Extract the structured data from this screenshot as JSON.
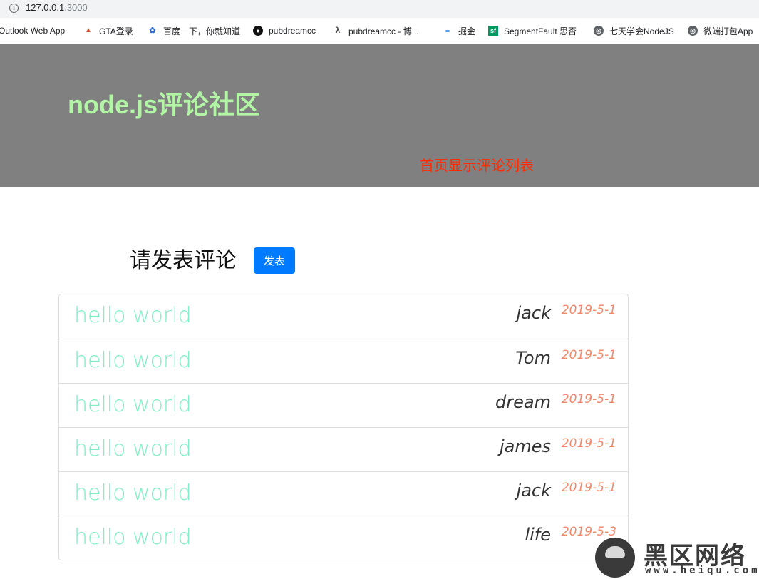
{
  "browser": {
    "url_host": "127.0.0.1",
    "url_port": ":3000",
    "bookmarks": [
      {
        "label": "Outlook Web App",
        "icon": "outlook-icon"
      },
      {
        "label": "GTA登录",
        "icon": "gta-icon"
      },
      {
        "label": "百度一下，你就知道",
        "icon": "baidu-paw-icon"
      },
      {
        "label": "pubdreamcc",
        "icon": "github-icon"
      },
      {
        "label": "pubdreamcc - 博...",
        "icon": "cnblogs-icon"
      },
      {
        "label": "掘金",
        "icon": "juejin-icon"
      },
      {
        "label": "SegmentFault 思否",
        "icon": "segmentfault-icon"
      },
      {
        "label": "七天学会NodeJS",
        "icon": "globe-icon"
      },
      {
        "label": "微端打包App",
        "icon": "globe-icon"
      }
    ]
  },
  "header": {
    "title": "node.js评论社区",
    "link": "首页显示评论列表"
  },
  "compose": {
    "title": "请发表评论",
    "button": "发表"
  },
  "comments": [
    {
      "content": "hello world",
      "author": "jack",
      "date": "2019-5-1"
    },
    {
      "content": "hello world",
      "author": "Tom",
      "date": "2019-5-1"
    },
    {
      "content": "hello world",
      "author": "dream",
      "date": "2019-5-1"
    },
    {
      "content": "hello world",
      "author": "james",
      "date": "2019-5-1"
    },
    {
      "content": "hello world",
      "author": "jack",
      "date": "2019-5-1"
    },
    {
      "content": "hello world",
      "author": "life",
      "date": "2019-5-3"
    }
  ],
  "watermark": {
    "title": "黑区网络",
    "url": "www.heiqu.com"
  },
  "colors": {
    "header_bg": "#808080",
    "title": "#b2f5a5",
    "header_link": "#ff2a00",
    "button": "#007bff",
    "comment_text": "#7ff0c4",
    "date": "#f08a6c"
  }
}
